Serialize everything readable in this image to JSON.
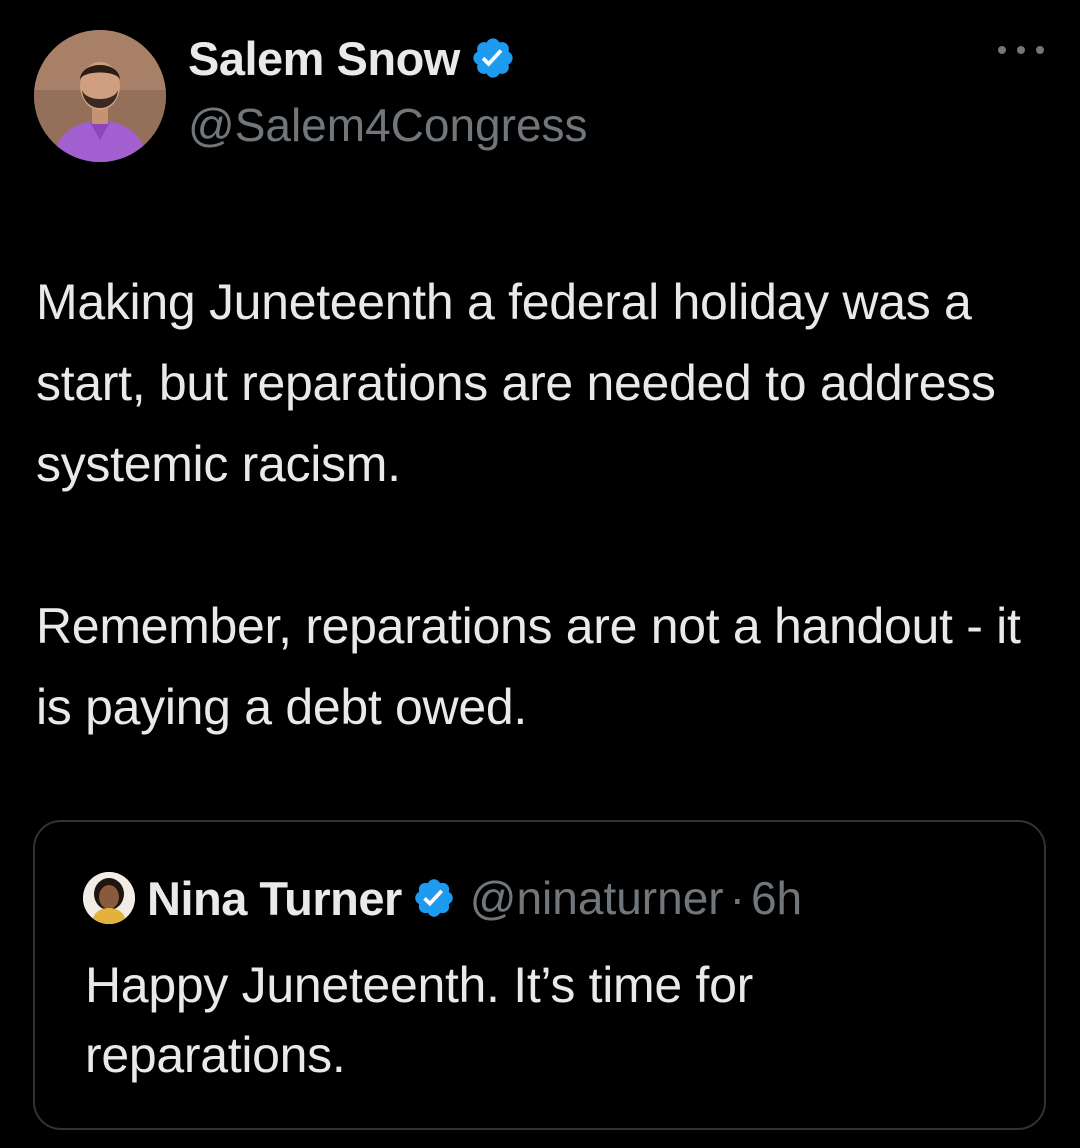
{
  "author": {
    "name": "Salem Snow",
    "handle": "@Salem4Congress",
    "verified": true,
    "avatar": "profile-photo"
  },
  "more_icon": "more-horizontal-icon",
  "tweet": {
    "paragraph_1": "Making Juneteenth a federal holiday was a start, but reparations are needed to address systemic racism.",
    "paragraph_2": "Remember, reparations are not a handout - it is paying a debt owed."
  },
  "quoted_tweet": {
    "name": "Nina Turner",
    "handle": "@ninaturner",
    "separator": "·",
    "time": "6h",
    "verified": true,
    "text": "Happy Juneteenth. It’s time for reparations."
  },
  "colors": {
    "background": "#000000",
    "primary_text": "#e7e9ea",
    "secondary_text": "#71767b",
    "verified_badge": "#1d9bf0",
    "border": "#2f3336"
  }
}
